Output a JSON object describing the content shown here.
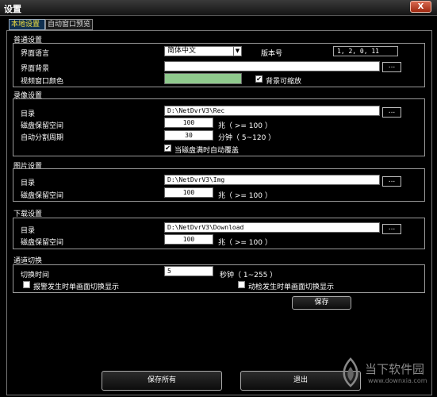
{
  "window": {
    "title": "设置",
    "close_label": "X"
  },
  "tabs": [
    {
      "label": "本地设置",
      "active": true
    },
    {
      "label": "自动窗口预览",
      "active": false
    }
  ],
  "general": {
    "title": "普通设置",
    "language_label": "界面语言",
    "language_value": "简体中文",
    "version_label": "版本号",
    "version_value": "1, 2, 0, 11",
    "background_label": "界面背景",
    "background_value": "",
    "video_color_label": "视频窗口颜色",
    "video_color": "#8fc98d",
    "scalable_label": "背景可缩放",
    "scalable_checked": true
  },
  "record": {
    "title": "录像设置",
    "dir_label": "目录",
    "dir_value": "D:\\NetDvrV3\\Rec",
    "reserve_label": "磁盘保留空间",
    "reserve_value": "100",
    "reserve_unit": "兆（ >= 100 ）",
    "split_label": "自动分割周期",
    "split_value": "30",
    "split_unit": "分钟（ 5~120 ）",
    "overwrite_label": "当磁盘满时自动覆盖",
    "overwrite_checked": true
  },
  "picture": {
    "title": "图片设置",
    "dir_label": "目录",
    "dir_value": "D:\\NetDvrV3\\Img",
    "reserve_label": "磁盘保留空间",
    "reserve_value": "100",
    "reserve_unit": "兆（ >= 100 ）"
  },
  "download": {
    "title": "下载设置",
    "dir_label": "目录",
    "dir_value": "D:\\NetDvrV3\\Download",
    "reserve_label": "磁盘保留空间",
    "reserve_value": "100",
    "reserve_unit": "兆（ >= 100 ）"
  },
  "channel": {
    "title": "通道切换",
    "switch_label": "切换时间",
    "switch_value": "5",
    "switch_unit": "秒钟（ 1~255 ）",
    "alarm_label": "报警发生时单画面切换显示",
    "alarm_checked": false,
    "motion_label": "动检发生时单画面切换显示",
    "motion_checked": false,
    "save_label": "保存"
  },
  "browse_label": "...",
  "footer": {
    "save_all_label": "保存所有",
    "exit_label": "退出"
  },
  "watermark": {
    "text": "当下软件园",
    "url": "www.downxia.com"
  }
}
